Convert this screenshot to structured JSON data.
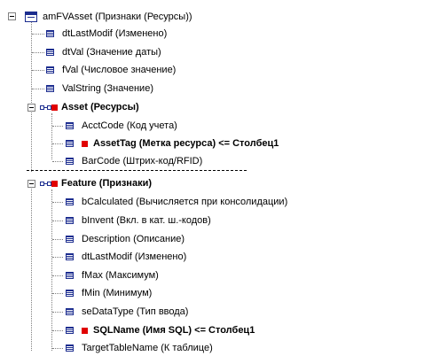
{
  "tree": {
    "root": {
      "label": "amFVAsset (Признаки (Ресурсы))",
      "icon": "table-icon"
    },
    "root_fields": [
      {
        "label": "dtLastModif (Изменено)"
      },
      {
        "label": "dtVal (Значение даты)"
      },
      {
        "label": "fVal (Числовое значение)"
      },
      {
        "label": "ValString (Значение)"
      }
    ],
    "asset_link": {
      "label": "Asset (Ресурсы)",
      "icon": "link-icon"
    },
    "asset_fields": [
      {
        "label": "AcctCode (Код учета)",
        "marked": false
      },
      {
        "label": "AssetTag (Метка ресурса)  <=  Столбец1",
        "marked": true
      },
      {
        "label": "BarCode (Штрих-код/RFID)",
        "marked": false
      }
    ],
    "feature_link": {
      "label": "Feature (Признаки)",
      "icon": "link-icon"
    },
    "feature_fields": [
      {
        "label": "bCalculated (Вычисляется при консолидации)",
        "marked": false
      },
      {
        "label": "bInvent (Вкл. в кат. ш.-кодов)",
        "marked": false
      },
      {
        "label": "Description (Описание)",
        "marked": false
      },
      {
        "label": "dtLastModif (Изменено)",
        "marked": false
      },
      {
        "label": "fMax (Максимум)",
        "marked": false
      },
      {
        "label": "fMin (Минимум)",
        "marked": false
      },
      {
        "label": "seDataType (Тип ввода)",
        "marked": false
      },
      {
        "label": "SQLName (Имя SQL)  <=  Столбец1",
        "marked": true
      },
      {
        "label": "TargetTableName (К таблице)",
        "marked": false
      }
    ]
  },
  "colors": {
    "icon_blue": "#1c2d8f",
    "mark_red": "#e00000",
    "tree_line": "#808080"
  }
}
